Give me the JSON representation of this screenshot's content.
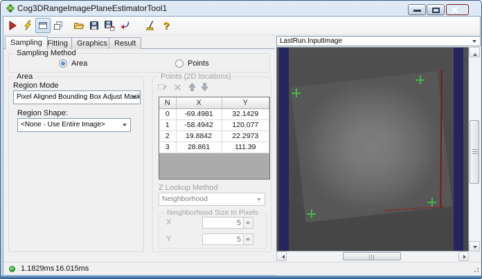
{
  "window": {
    "title": "Cog3DRangeImagePlaneEstimatorTool1"
  },
  "toolbar": {
    "help_glyph": "?",
    "icons": [
      "run",
      "lightning",
      "float-window",
      "stack-windows",
      "open-file",
      "save",
      "save-as",
      "import-reset",
      "pointer-tool",
      "help"
    ]
  },
  "tabs": [
    "Sampling",
    "Fitting",
    "Graphics",
    "Result"
  ],
  "sampling": {
    "group_label": "Sampling Method",
    "area_label": "Area",
    "points_label": "Points"
  },
  "area": {
    "group_label": "Area",
    "region_mode_label": "Region Mode",
    "region_mode_value": "Pixel Aligned Bounding Box Adjust Mask",
    "region_shape_label": "Region Shape:",
    "region_shape_value": "<None - Use Entire Image>"
  },
  "points": {
    "group_label": "Points (2D locations)",
    "table": {
      "headers": [
        "N",
        "X",
        "Y"
      ],
      "rows": [
        [
          "0",
          "-69.4981",
          "32.1429"
        ],
        [
          "1",
          "-58.4942",
          "120.077"
        ],
        [
          "2",
          "19.8842",
          "22.2973"
        ],
        [
          "3",
          "28.861",
          "111.39"
        ]
      ]
    },
    "z_lookup_label": "Z Lookup Method",
    "z_lookup_value": "Neighborhood",
    "size_group_label": "Neighborhood Size In Pixels",
    "x_label": "X",
    "x_value": "5",
    "y_label": "Y",
    "y_value": "5"
  },
  "display": {
    "image_selector": "LastRun.InputImage"
  },
  "status": {
    "time_a": "1.1829ms",
    "time_b": "16.015ms"
  },
  "colors": {
    "accent_navy": "#26245e",
    "marker_green": "#46b946",
    "edge_red": "#7e1717",
    "run_red": "#c62c2c"
  }
}
